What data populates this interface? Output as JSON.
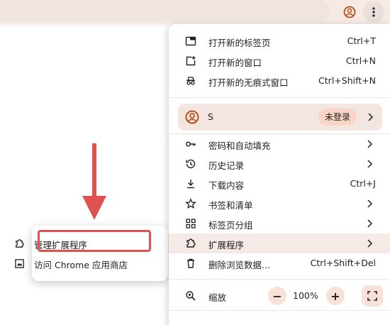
{
  "menu": {
    "items": [
      {
        "label": "打开新的标签页",
        "shortcut": "Ctrl+T",
        "icon": "new-tab-icon"
      },
      {
        "label": "打开新的窗口",
        "shortcut": "Ctrl+N",
        "icon": "new-window-icon"
      },
      {
        "label": "打开新的无痕式窗口",
        "shortcut": "Ctrl+Shift+N",
        "icon": "incognito-icon"
      }
    ],
    "profile": {
      "name": "S",
      "status": "未登录"
    },
    "items2": [
      {
        "label": "密码和自动填充",
        "icon": "key-icon"
      },
      {
        "label": "历史记录",
        "icon": "history-icon"
      },
      {
        "label": "下载内容",
        "shortcut": "Ctrl+J",
        "icon": "download-icon"
      },
      {
        "label": "书签和清单",
        "icon": "star-icon"
      },
      {
        "label": "标签页分组",
        "icon": "grid-icon"
      },
      {
        "label": "扩展程序",
        "icon": "puzzle-icon"
      },
      {
        "label": "删除浏览数据...",
        "shortcut": "Ctrl+Shift+Del",
        "icon": "trash-icon"
      }
    ],
    "zoom": {
      "label": "缩放",
      "minus": "−",
      "level": "100%",
      "plus": "+"
    }
  },
  "submenu": {
    "items": [
      {
        "label": "管理扩展程序",
        "icon": "puzzle-icon"
      },
      {
        "label": "访问 Chrome 应用商店",
        "icon": "store-icon"
      }
    ]
  },
  "colors": {
    "accent": "#b5541e",
    "arrow": "#e0524d",
    "hover": "#f4ebe7",
    "badge": "#f8d5c4"
  }
}
